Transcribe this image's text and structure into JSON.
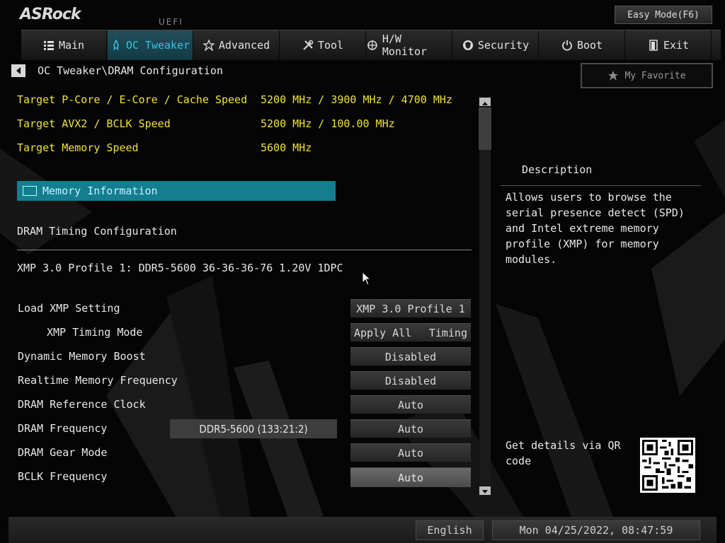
{
  "header": {
    "logo": "ASRock",
    "uefi_label": "UEFI",
    "easy_mode": "Easy Mode(F6)"
  },
  "tabs": [
    {
      "label": "Main",
      "icon": "list-icon",
      "active": false
    },
    {
      "label": "OC Tweaker",
      "icon": "rocket-icon",
      "active": true
    },
    {
      "label": "Advanced",
      "icon": "star-icon",
      "active": false
    },
    {
      "label": "Tool",
      "icon": "tools-icon",
      "active": false
    },
    {
      "label": "H/W Monitor",
      "icon": "crosshair-icon",
      "active": false
    },
    {
      "label": "Security",
      "icon": "shield-icon",
      "active": false
    },
    {
      "label": "Boot",
      "icon": "power-icon",
      "active": false
    },
    {
      "label": "Exit",
      "icon": "exit-icon",
      "active": false
    }
  ],
  "breadcrumb": "OC Tweaker\\DRAM Configuration",
  "favorite": "My Favorite",
  "targets": [
    {
      "label": "Target P-Core / E-Core / Cache Speed",
      "value": "5200 MHz / 3900 MHz / 4700 MHz"
    },
    {
      "label": "Target AVX2 / BCLK Speed",
      "value": "5200 MHz / 100.00 MHz"
    },
    {
      "label": "Target Memory Speed",
      "value": "5600 MHz"
    }
  ],
  "memory_information": "Memory Information",
  "timing_title": "DRAM Timing Configuration",
  "xmp_profile": "XMP 3.0 Profile 1: DDR5-5600 36-36-36-76 1.20V 1DPC",
  "settings": [
    {
      "label": "Load XMP Setting",
      "value": "XMP 3.0 Profile 1"
    },
    {
      "label": "XMP Timing Mode",
      "value_left": "Apply All",
      "value_right": "Timing"
    },
    {
      "label": "Dynamic Memory Boost",
      "value": "Disabled"
    },
    {
      "label": "Realtime Memory Frequency",
      "value": "Disabled"
    },
    {
      "label": "DRAM Reference Clock",
      "value": "Auto"
    },
    {
      "label": "DRAM Frequency",
      "value": "Auto",
      "current": "DDR5-5600 (133:21:2)"
    },
    {
      "label": "DRAM Gear Mode",
      "value": "Auto"
    },
    {
      "label": "BCLK Frequency",
      "value": "Auto"
    }
  ],
  "description": {
    "title": "Description",
    "text": "Allows users to browse the serial presence detect (SPD) and Intel extreme memory profile (XMP) for memory modules.",
    "qr_text": "Get details via QR code"
  },
  "footer": {
    "language": "English",
    "datetime": "Mon 04/25/2022, 08:47:59"
  },
  "colors": {
    "accent": "#157d90",
    "active_tab_text": "#35c3e0",
    "target_text": "#f0e23a"
  }
}
